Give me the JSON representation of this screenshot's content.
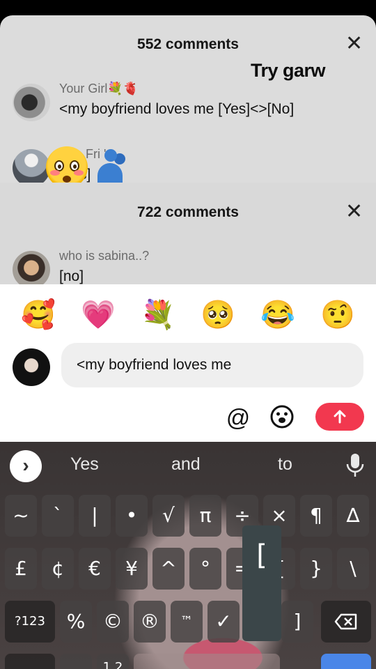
{
  "first_sheet": {
    "title": "552 comments",
    "overlay_text": "Try garw",
    "comments": [
      {
        "username": "Your Girl💐🫀",
        "text": "<my boyfriend loves me [Yes]<>[No]"
      },
      {
        "username": "Fri   's",
        "text": "s]"
      }
    ]
  },
  "second_sheet": {
    "title": "722 comments",
    "comments": [
      {
        "username": "who is sabina..?",
        "text": "[no]"
      }
    ]
  },
  "reply": {
    "emoji_bar": [
      "🥰",
      "💗",
      "💐",
      "🥺",
      "😂",
      "🤨"
    ],
    "input_value": "<my boyfriend loves me",
    "mention_icon": "@",
    "emoji_icon": "☺",
    "send_icon": "arrow-up"
  },
  "keyboard": {
    "suggestions": [
      "Yes",
      "and",
      "to"
    ],
    "row1": [
      "~",
      "`",
      "|",
      "•",
      "√",
      "π",
      "÷",
      "×",
      "¶",
      "∆"
    ],
    "row2": [
      "£",
      "¢",
      "€",
      "¥",
      "^",
      "°",
      "=",
      "{",
      "}",
      "\\"
    ],
    "row3": [
      "?123",
      "%",
      "©",
      "®",
      "™",
      "✓",
      "[",
      "]"
    ],
    "row4_partial": [
      "1 2"
    ],
    "popup_char": "[",
    "colors": {
      "send": "#f2384f",
      "enter": "#4a86e8"
    }
  }
}
